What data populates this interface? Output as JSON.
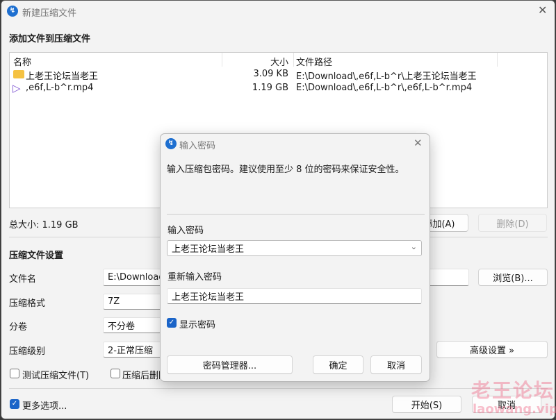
{
  "window": {
    "title": "新建压缩文件",
    "heading": "添加文件到压缩文件",
    "close_icon": "close-icon"
  },
  "file_list": {
    "columns": [
      "名称",
      "大小",
      "文件路径"
    ],
    "rows": [
      {
        "icon": "folder-icon",
        "name": "上老王论坛当老王",
        "size": "3.09 KB",
        "path": "E:\\Download\\,e6f,L-b^r\\上老王论坛当老王"
      },
      {
        "icon": "video-file-icon",
        "name": ",e6f,L-b^r.mp4",
        "size": "1.19 GB",
        "path": "E:\\Download\\,e6f,L-b^r\\,e6f,L-b^r.mp4"
      }
    ]
  },
  "total_size": "总大小: 1.19 GB",
  "add_button": "添加(A)",
  "delete_button": "删除(D)",
  "settings": {
    "heading": "压缩文件设置",
    "filename_label": "文件名",
    "filename_value": "E:\\Download\\",
    "browse_button": "浏览(B)...",
    "format_label": "压缩格式",
    "format_value": "7Z",
    "split_label": "分卷",
    "split_value": "不分卷",
    "level_label": "压缩级别",
    "level_value": "2-正常压缩",
    "advanced_button": "高级设置 »",
    "test_checkbox": "测试压缩文件(T)",
    "test_checked": false,
    "delete_after_checkbox": "压缩后删除",
    "delete_after_checked": false
  },
  "more_options": {
    "label": "更多选项...",
    "checked": true
  },
  "start_button": "开始(S)",
  "cancel_button": "取消",
  "watermark": {
    "line1": "老王论坛",
    "line2": "laowang.vip"
  },
  "password_dialog": {
    "title": "输入密码",
    "description": "输入压缩包密码。建议使用至少 8 位的密码来保证安全性。",
    "password_label": "输入密码",
    "password_value": "上老王论坛当老王",
    "confirm_label": "重新输入密码",
    "confirm_value": "上老王论坛当老王",
    "show_password": "显示密码",
    "show_password_checked": true,
    "manager_button": "密码管理器...",
    "ok_button": "确定",
    "cancel_button": "取消"
  }
}
